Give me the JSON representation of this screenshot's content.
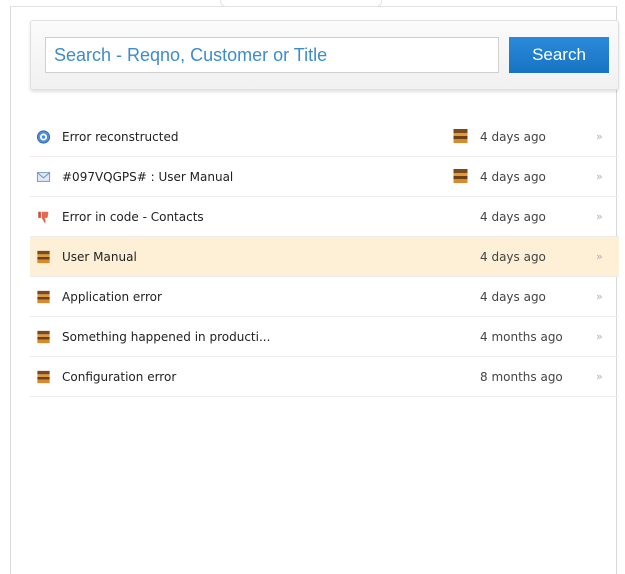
{
  "search": {
    "placeholder": "Search - Reqno, Customer or Title",
    "value": "",
    "button_label": "Search"
  },
  "tickets": [
    {
      "title": "Error reconstructed",
      "time": "4 days ago",
      "type_icon": "settings-circle-icon",
      "has_owner_icon": true,
      "owner_icon": "briefcase-icon",
      "arrow": "»",
      "highlighted": false
    },
    {
      "title": "#097VQGPS# : User Manual",
      "time": "4 days ago",
      "type_icon": "email-icon",
      "has_owner_icon": true,
      "owner_icon": "briefcase-icon",
      "arrow": "»",
      "highlighted": false
    },
    {
      "title": "Error in code - Contacts",
      "time": "4 days ago",
      "type_icon": "thumbs-down-icon",
      "has_owner_icon": false,
      "arrow": "»",
      "highlighted": false
    },
    {
      "title": "User Manual",
      "time": "4 days ago",
      "type_icon": "briefcase-icon",
      "has_owner_icon": false,
      "arrow": "»",
      "highlighted": true
    },
    {
      "title": "Application error",
      "time": "4 days ago",
      "type_icon": "briefcase-icon",
      "has_owner_icon": false,
      "arrow": "»",
      "highlighted": false
    },
    {
      "title": "Something happened in producti...",
      "time": "4 months ago",
      "type_icon": "briefcase-icon",
      "has_owner_icon": false,
      "arrow": "»",
      "highlighted": false
    },
    {
      "title": "Configuration error",
      "time": "8 months ago",
      "type_icon": "briefcase-icon",
      "has_owner_icon": false,
      "arrow": "»",
      "highlighted": false
    }
  ],
  "colors": {
    "accent": "#1f80cf",
    "highlight_row": "#fdf0d6",
    "search_text": "#3c8cc9"
  }
}
